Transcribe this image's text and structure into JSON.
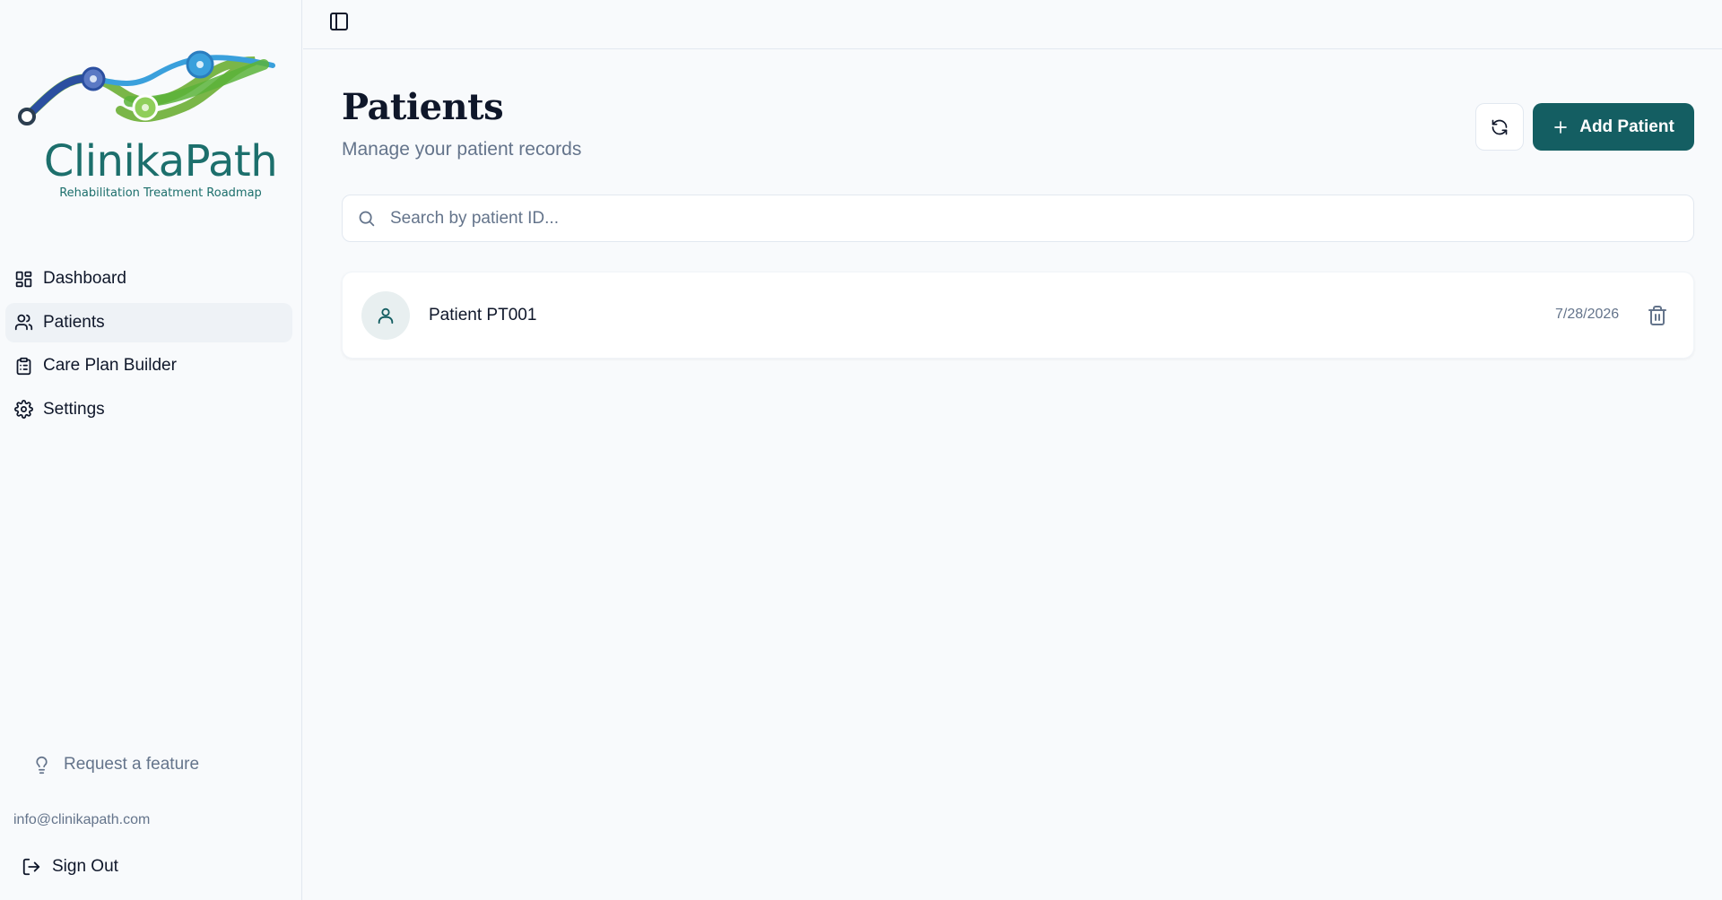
{
  "brand": {
    "name": "ClinikaPath",
    "tagline": "Rehabilitation Treatment Roadmap",
    "color": "#1c6f6c"
  },
  "sidebar": {
    "items": [
      {
        "label": "Dashboard",
        "icon": "dashboard-icon",
        "active": false
      },
      {
        "label": "Patients",
        "icon": "users-icon",
        "active": true
      },
      {
        "label": "Care Plan Builder",
        "icon": "clipboard-icon",
        "active": false
      },
      {
        "label": "Settings",
        "icon": "gear-icon",
        "active": false
      }
    ],
    "feature_request": "Request a feature",
    "email": "info@clinikapath.com",
    "sign_out": "Sign Out"
  },
  "header": {
    "title": "Patients",
    "subtitle": "Manage your patient records"
  },
  "actions": {
    "refresh_icon": "refresh-icon",
    "add_label": "Add Patient",
    "accent": "#145e62"
  },
  "search": {
    "placeholder": "Search by patient ID...",
    "value": ""
  },
  "patients": [
    {
      "name": "Patient PT001",
      "date": "7/28/2026"
    }
  ]
}
